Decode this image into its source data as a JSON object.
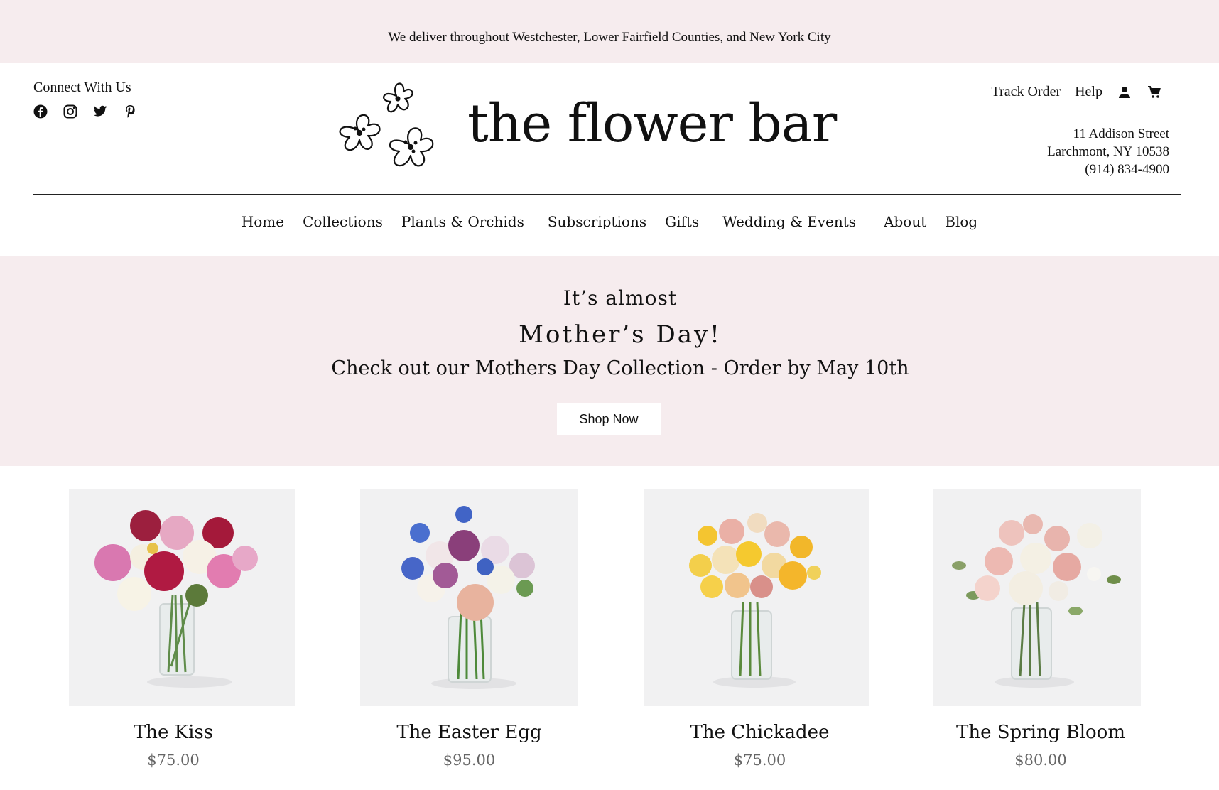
{
  "announcement": "We deliver throughout Westchester,  Lower Fairfield Counties, and New York City",
  "header": {
    "connect_label": "Connect With Us",
    "social_icons": [
      "facebook-icon",
      "instagram-icon",
      "twitter-icon",
      "pinterest-icon"
    ],
    "brand": "the flower bar",
    "track_order": "Track Order",
    "help": "Help",
    "address": {
      "street": "11 Addison Street",
      "city": "Larchmont, NY 10538",
      "phone": "(914) 834-4900"
    }
  },
  "nav": {
    "items": [
      {
        "label": "Home"
      },
      {
        "label": "Collections"
      },
      {
        "label": "Plants & Orchids"
      },
      {
        "label": "Subscriptions"
      },
      {
        "label": "Gifts"
      },
      {
        "label": "Wedding & Events"
      },
      {
        "label": "About"
      },
      {
        "label": "Blog"
      }
    ]
  },
  "hero": {
    "line1": "It’s almost",
    "line2": "Mother’s Day!",
    "line3": "Check out our Mothers Day Collection -  Order by May 10th",
    "button": "Shop Now"
  },
  "products": [
    {
      "name": "The Kiss",
      "price": "$75.00"
    },
    {
      "name": "The Easter Egg",
      "price": "$95.00"
    },
    {
      "name": "The Chickadee",
      "price": "$75.00"
    },
    {
      "name": "The Spring Bloom",
      "price": "$80.00"
    }
  ],
  "colors": {
    "pink_band": "#f6ecee",
    "card_bg": "#f1f1f2",
    "price_gray": "#666666"
  }
}
